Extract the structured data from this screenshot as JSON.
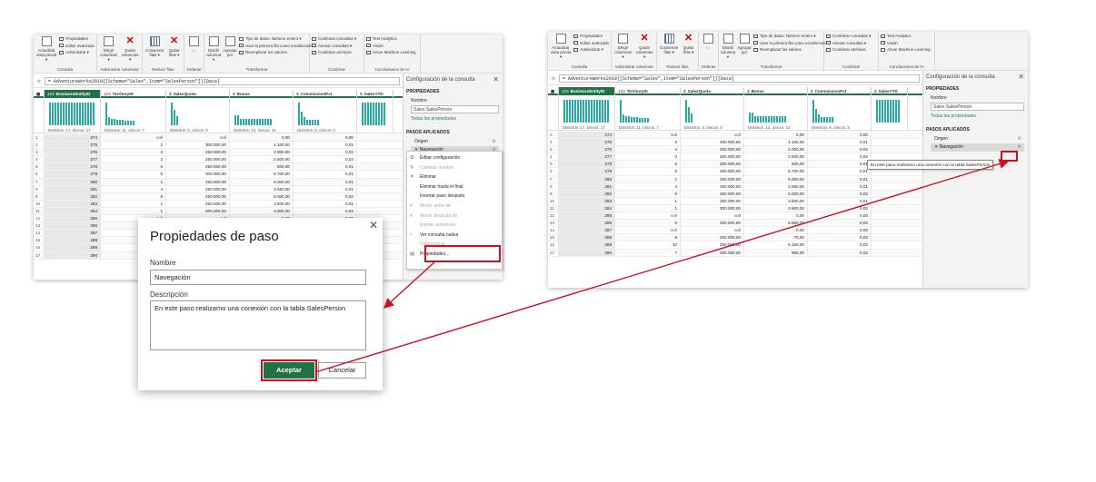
{
  "accent_color": "#217346",
  "highlight_color": "#d10d1f",
  "ribbon": {
    "groups": [
      {
        "label": "Consulta",
        "buttons": [
          "Actualizar vista previa ▾"
        ],
        "smalls": [
          "Propiedades",
          "Editor avanzado",
          "Administrar ▾"
        ]
      },
      {
        "label": "Administrar columnas",
        "buttons": [
          "Elegir columnas ▾",
          "Quitar columnas ▾"
        ],
        "smalls": []
      },
      {
        "label": "Reducir filas",
        "buttons": [
          "Conservar filas ▾",
          "Quitar filas ▾"
        ],
        "smalls": []
      },
      {
        "label": "Ordenar",
        "buttons": [
          "↑↓"
        ],
        "smalls": []
      },
      {
        "label": "Transformar",
        "buttons": [
          "Dividir columna ▾",
          "Agrupar por"
        ],
        "smalls": [
          "Tipo de datos: Número entero ▾",
          "Usar la primera fila como encabezado ▾",
          "Reemplazar los valores"
        ]
      },
      {
        "label": "Combinar",
        "buttons": [],
        "smalls": [
          "Combinar consultas ▾",
          "Anexar consultas ▾",
          "Combinar archivos"
        ]
      },
      {
        "label": "Conclusiones de IA",
        "buttons": [],
        "smalls": [
          "Text Analytics",
          "Visión",
          "Azure Machine Learning"
        ]
      }
    ]
  },
  "formula": "= AdventureWorks2019{[Schema=\"Sales\",Item=\"SalesPerson\"]}[Data]",
  "fx": "fx",
  "columns": [
    {
      "name": "BusinessEntityID",
      "type": "123"
    },
    {
      "name": "TerritoryID",
      "type": "123"
    },
    {
      "name": "SalesQuota",
      "type": "$"
    },
    {
      "name": "Bonus",
      "type": "$"
    },
    {
      "name": "CommissionPct",
      "type": "$"
    },
    {
      "name": "SalesYTD",
      "type": "$"
    }
  ],
  "profile_captions": [
    "Distintos: 17, únicos: 17",
    "Distintos: 11, únicos: 7",
    "Distintos: 3, únicos: 0",
    "Distintos: 14, únicos: 12",
    "Distintos: 8, únicos: 3",
    ""
  ],
  "rows": [
    [
      "1",
      "274",
      "null",
      "null",
      "0,00",
      "0,00"
    ],
    [
      "2",
      "275",
      "2",
      "300.000,00",
      "4.100,00",
      "0,01"
    ],
    [
      "3",
      "276",
      "4",
      "250.000,00",
      "2.000,00",
      "0,02"
    ],
    [
      "4",
      "277",
      "3",
      "250.000,00",
      "2.500,00",
      "0,02"
    ],
    [
      "5",
      "278",
      "6",
      "250.000,00",
      "500,00",
      "0,01"
    ],
    [
      "6",
      "279",
      "5",
      "300.000,00",
      "6.700,00",
      "0,01"
    ],
    [
      "7",
      "280",
      "1",
      "250.000,00",
      "5.000,00",
      "0,01"
    ],
    [
      "8",
      "281",
      "4",
      "250.000,00",
      "3.550,00",
      "0,01"
    ],
    [
      "9",
      "282",
      "6",
      "250.000,00",
      "5.000,00",
      "0,02"
    ],
    [
      "10",
      "283",
      "1",
      "250.000,00",
      "3.500,00",
      "0,01"
    ],
    [
      "11",
      "284",
      "1",
      "300.000,00",
      "3.900,00",
      "0,02"
    ],
    [
      "12",
      "285",
      "null",
      "null",
      "0,00",
      "0,00"
    ],
    [
      "13",
      "286",
      "9",
      "250.000,00",
      "5.650,00",
      "0,02"
    ],
    [
      "14",
      "287",
      "null",
      "null",
      "0,00",
      "0,00"
    ],
    [
      "15",
      "288",
      "8",
      "250.000,00",
      "75,00",
      "0,02"
    ],
    [
      "16",
      "289",
      "10",
      "250.000,00",
      "5.150,00",
      "0,02"
    ],
    [
      "17",
      "290",
      "7",
      "250.000,00",
      "985,00",
      "0,02"
    ]
  ],
  "pane": {
    "title": "Configuración de la consulta",
    "props_header": "PROPIEDADES",
    "name_label": "Nombre",
    "name_value": "Sales SalesPerson",
    "all_props": "Todas las propiedades",
    "steps_header": "PASOS APLICADOS",
    "steps": [
      "Origen",
      "Navegación"
    ]
  },
  "context_menu": {
    "items": [
      {
        "label": "Editar configuración",
        "icon": "⚙",
        "disabled": false
      },
      {
        "label": "Cambiar nombre",
        "icon": "✎",
        "disabled": true
      },
      {
        "label": "Eliminar",
        "icon": "✕",
        "disabled": false
      },
      {
        "label": "Eliminar hasta el final",
        "icon": "",
        "disabled": false
      },
      {
        "label": "Insertar paso después",
        "icon": "",
        "disabled": false
      },
      {
        "label": "Mover antes de",
        "icon": "˄",
        "disabled": true
      },
      {
        "label": "Mover después de",
        "icon": "˅",
        "disabled": true
      },
      {
        "label": "Extraer anteriores",
        "icon": "",
        "disabled": true
      },
      {
        "label": "Ver consulta nativa",
        "icon": "▫",
        "disabled": false
      },
      {
        "label": "Diagnosticar",
        "icon": "",
        "disabled": true
      },
      {
        "label": "Propiedades...",
        "icon": "▤",
        "disabled": false
      }
    ]
  },
  "dialog": {
    "title": "Propiedades de paso",
    "name_label": "Nombre",
    "name_value": "Navegación",
    "desc_label": "Descripción",
    "desc_value": "En este paso realizamo una conexión con la tabla SalesPerson",
    "ok": "Aceptar",
    "cancel": "Cancelar"
  },
  "tooltip": "En este paso realizamo una conexión con la tabla SalesPerson"
}
